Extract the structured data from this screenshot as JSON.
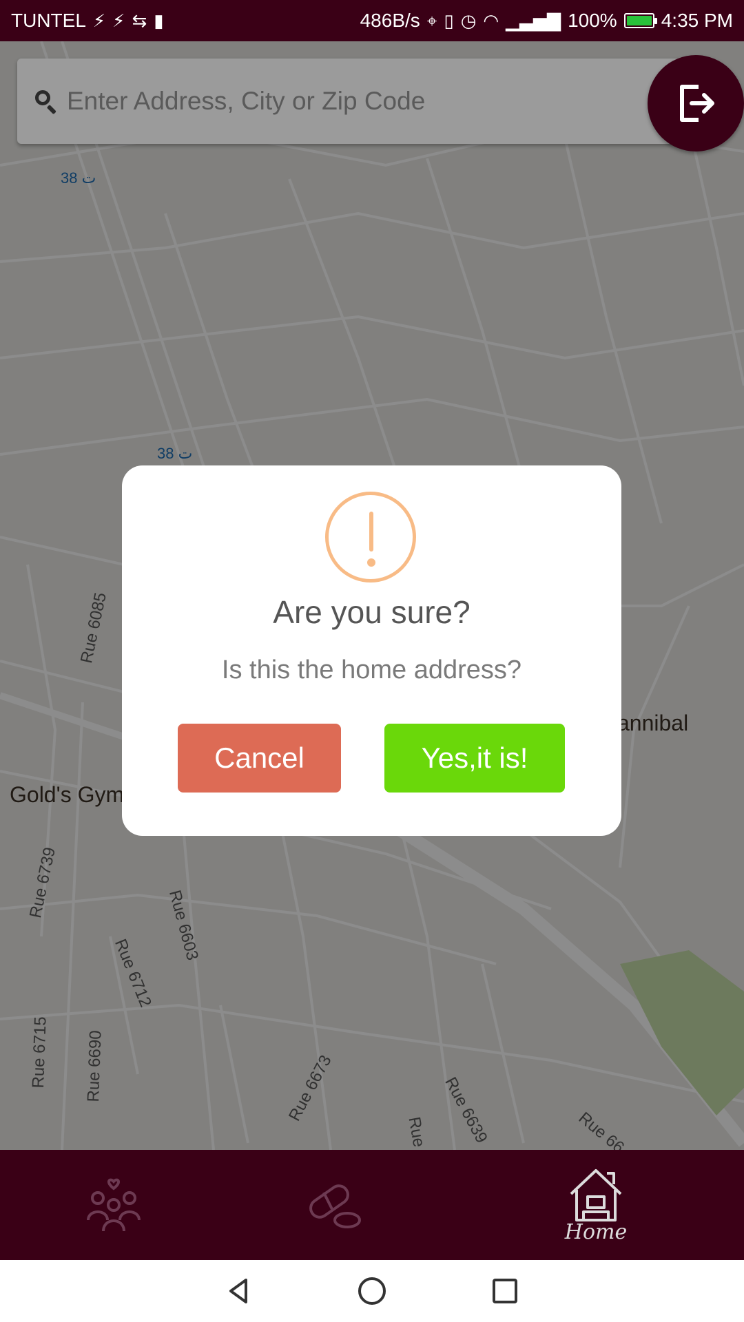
{
  "status_bar": {
    "carrier": "TUNTEL",
    "net_speed": "486B/s",
    "battery": "100%",
    "battery_level": 1.0,
    "time": "4:35 PM"
  },
  "search": {
    "placeholder": "Enter Address, City or Zip Code"
  },
  "map": {
    "bus_stop_1": "ت 38",
    "bus_stop_2": "ت 38",
    "street_labels": [
      "Rue 6085",
      "Rue 6739",
      "Rue 6603",
      "Rue 6712",
      "Rue 6715",
      "Rue 6690",
      "Rue 6673",
      "Rue 6639",
      "Rue",
      "Rue 66"
    ],
    "poi_golds_gym": "Gold's Gym",
    "poi_hannibal": "annibal"
  },
  "dialog": {
    "title": "Are you sure?",
    "text": "Is this the home address?",
    "cancel_label": "Cancel",
    "confirm_label": "Yes,it is!"
  },
  "bottom_nav": {
    "home_label": "Home"
  },
  "colors": {
    "brand": "#3a0016",
    "cancel": "#dd6b55",
    "confirm": "#6ad80a",
    "warning": "#f8bb86"
  }
}
